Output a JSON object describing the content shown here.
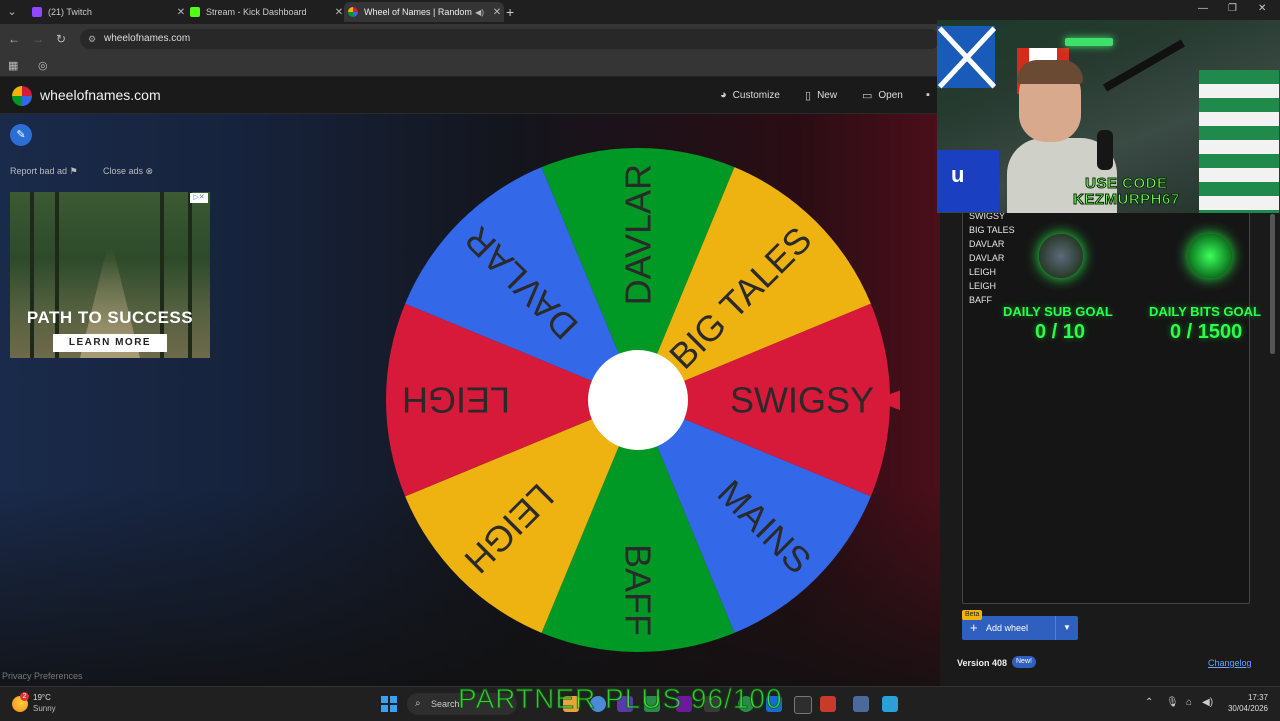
{
  "browser": {
    "tabs": [
      {
        "title": "(21) Twitch",
        "color": "#9146ff",
        "active": false
      },
      {
        "title": "Stream - Kick Dashboard",
        "color": "#53fc18",
        "active": false
      },
      {
        "title": "Wheel of Names | Random",
        "color": "#4a8ad6",
        "active": true
      }
    ],
    "url": "wheelofnames.com"
  },
  "site": {
    "name": "wheelofnames.com",
    "toolbar": {
      "customize": "Customize",
      "new": "New",
      "open": "Open"
    }
  },
  "ads": {
    "report": "Report bad ad",
    "close": "Close ads",
    "headline": "PATH TO SUCCESS",
    "cta": "LEARN MORE"
  },
  "wheel": {
    "segments": [
      {
        "label": "SWIGSY",
        "color": "#d7193a"
      },
      {
        "label": "MAINS",
        "color": "#3369e8"
      },
      {
        "label": "BAFF",
        "color": "#009925"
      },
      {
        "label": "LEIGH",
        "color": "#eeb211"
      },
      {
        "label": "LEIGH",
        "color": "#d7193a"
      },
      {
        "label": "DAVLAR",
        "color": "#3369e8"
      },
      {
        "label": "DAVLAR",
        "color": "#009925"
      },
      {
        "label": "BIG TALES",
        "color": "#eeb211"
      }
    ],
    "pointer_color": "#d7193a"
  },
  "entries": [
    "SWIGSY",
    "BIG TALES",
    "DAVLAR",
    "DAVLAR",
    "LEIGH",
    "LEIGH",
    "BAFF"
  ],
  "panel": {
    "beta": "Beta",
    "add_wheel": "Add wheel",
    "version": "Version 408",
    "new_badge": "New!",
    "changelog": "Changelog"
  },
  "privacy": "Privacy Preferences",
  "stream_overlay": {
    "promo_line1": "USE CODE",
    "promo_line2": "KEZMURPH67",
    "sub_goal": {
      "title": "DAILY SUB GOAL",
      "value": "0 / 10"
    },
    "bits_goal": {
      "title": "DAILY BITS GOAL",
      "value": "0 / 1500"
    },
    "partner_text": "PARTNER PLUS 96/100"
  },
  "taskbar": {
    "weather_temp": "19°C",
    "weather_desc": "Sunny",
    "weather_badge": "2",
    "search": "Search",
    "time": "17:37",
    "date": "30/04/2026"
  }
}
